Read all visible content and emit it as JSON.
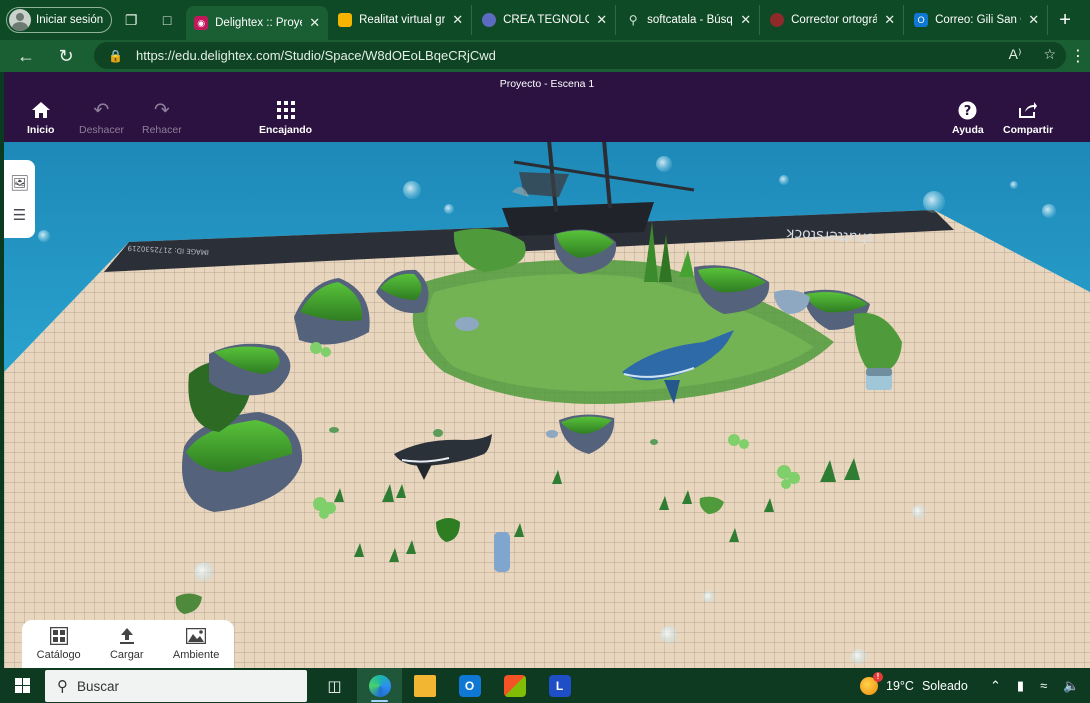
{
  "browser": {
    "profile_label": "Iniciar sesión",
    "tabs": [
      {
        "title": "Delightex :: Proyec",
        "favicon_color": "#c2185b",
        "active": true
      },
      {
        "title": "Realitat virtual gr",
        "favicon_color": "#f4b400",
        "active": false
      },
      {
        "title": "CREA TEGNOLOGI",
        "favicon_color": "#5c6bc0",
        "active": false
      },
      {
        "title": "softcatala - Búsqu",
        "favicon_color": "#1a5e33",
        "active": false
      },
      {
        "title": "Corrector ortográ",
        "favicon_color": "#8e2a2a",
        "active": false
      },
      {
        "title": "Correo: Gili San G",
        "favicon_color": "#0f78d4",
        "active": false
      }
    ],
    "url": "https://edu.delightex.com/Studio/Space/W8dOEoLBqeCRjCwd"
  },
  "app": {
    "scene_title": "Proyecto - Escena 1",
    "header_buttons": {
      "home": "Inicio",
      "undo": "Deshacer",
      "redo": "Rehacer",
      "snap": "Encajando",
      "help": "Ayuda",
      "share": "Compartir"
    },
    "bottom_toolbar": {
      "catalog": "Catálogo",
      "upload": "Cargar",
      "environment": "Ambiente"
    },
    "scene_texts": {
      "watermark_brand": "shutterstock",
      "watermark_id": "IMAGE ID: 2172530219"
    }
  },
  "taskbar": {
    "search_label": "Buscar",
    "weather_temp": "19°C",
    "weather_condition": "Soleado"
  },
  "colors": {
    "tab_strip": "#0f4a26",
    "address_bar": "#1a5e33",
    "app_header": "#2b1240",
    "water": "#2aa3cf",
    "sand": "#e8d2ba"
  }
}
